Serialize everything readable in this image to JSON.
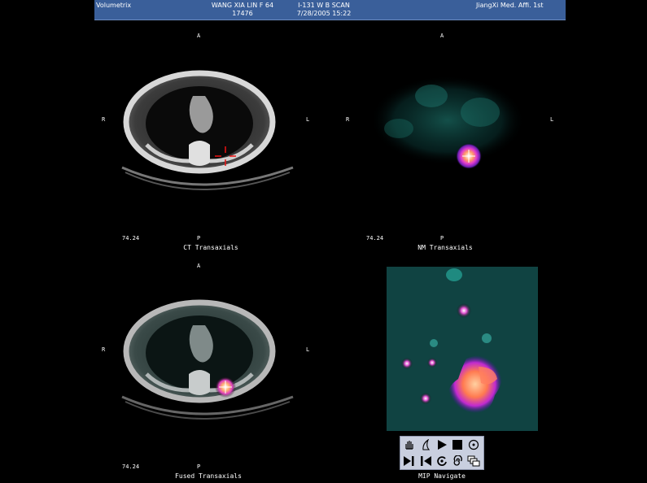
{
  "header": {
    "brand": "Volumetrix",
    "patient_name": "WANG XIA LIN F 64",
    "patient_id": "17476",
    "study": "I-131 W B SCAN",
    "datetime": "7/28/2005 15:22",
    "institution": "JiangXi Med. Affi. 1st"
  },
  "orientation": {
    "anterior": "A",
    "posterior": "P",
    "right": "R",
    "left": "L"
  },
  "panels": {
    "ct": {
      "title": "CT Transaxials",
      "slice": "74.24"
    },
    "nm": {
      "title": "NM Transaxials",
      "slice": "74.24"
    },
    "fused": {
      "title": "Fused Transaxials",
      "slice": "74.24"
    },
    "mip": {
      "title": "MIP Navigate"
    }
  },
  "toolbar": {
    "buttons": [
      "hand-tool-icon",
      "brightness-icon",
      "play-icon",
      "stop-icon",
      "target-icon",
      "next-frame-icon",
      "rotate-icon",
      "spiral-icon",
      "layers-icon"
    ]
  }
}
